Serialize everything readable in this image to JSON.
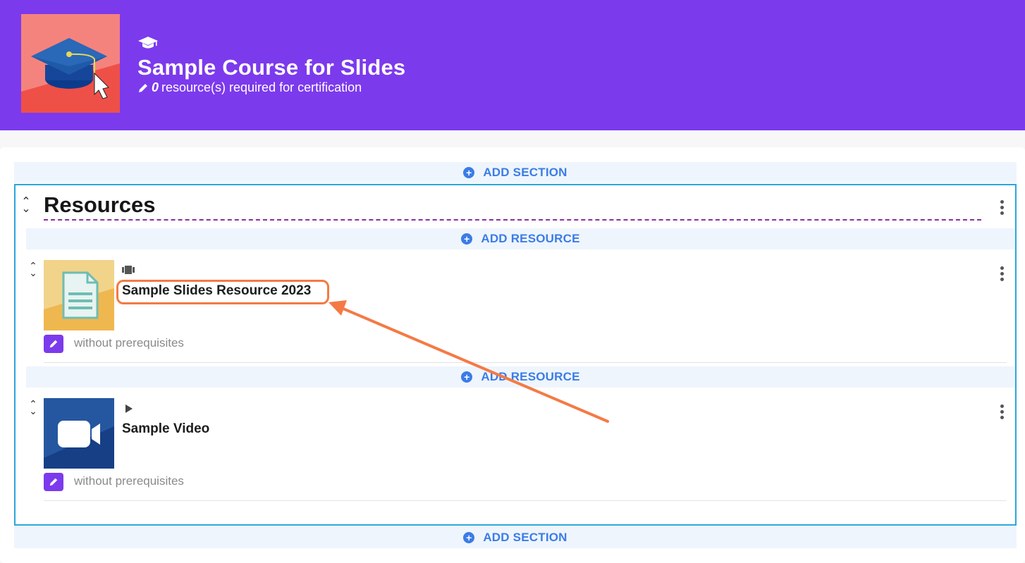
{
  "course": {
    "title": "Sample Course for Slides",
    "required_count": "0",
    "required_text": "resource(s) required for certification"
  },
  "add_section_label": "ADD SECTION",
  "add_resource_label": "ADD RESOURCE",
  "section": {
    "title": "Resources",
    "resources": [
      {
        "title": "Sample Slides Resource 2023",
        "type_icon": "slides-icon",
        "prereq": "without prerequisites"
      },
      {
        "title": "Sample Video",
        "type_icon": "play-icon",
        "prereq": "without prerequisites"
      }
    ]
  },
  "colors": {
    "header": "#7c3aed",
    "accent_blue": "#3b7ce6",
    "highlight": "#f47a45",
    "section_border": "#2ba6d9"
  }
}
